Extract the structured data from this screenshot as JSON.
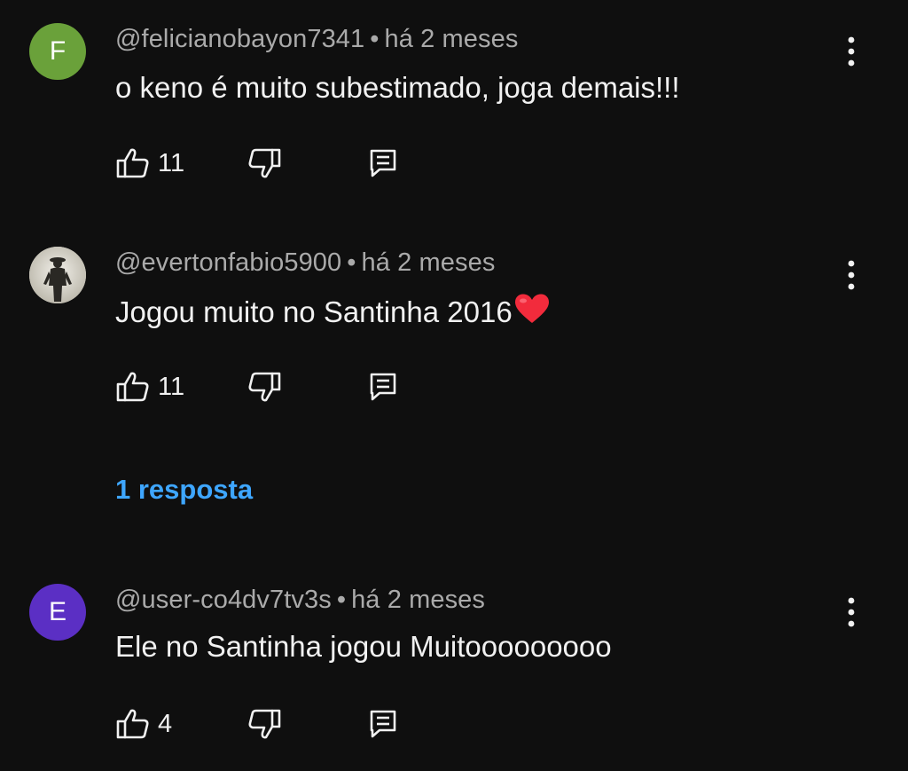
{
  "comments": [
    {
      "avatar": {
        "letter": "F",
        "color": "#6aa13a",
        "type": "letter"
      },
      "author": "@felicianobayon7341",
      "separator": "•",
      "time": "há 2 meses",
      "text": "o keno é muito subestimado, joga demais!!!",
      "likes": "11",
      "menu_icon": "more-vert-icon",
      "like_icon": "thumb-up-icon",
      "dislike_icon": "thumb-down-icon",
      "reply_icon": "reply-comment-icon"
    },
    {
      "avatar": {
        "type": "photo"
      },
      "author": "@evertonfabio5900",
      "separator": "•",
      "time": "há 2 meses",
      "text": "Jogou muito no Santinha 2016",
      "emoji": "❤️",
      "likes": "11",
      "replies": "1 resposta",
      "menu_icon": "more-vert-icon",
      "like_icon": "thumb-up-icon",
      "dislike_icon": "thumb-down-icon",
      "reply_icon": "reply-comment-icon"
    },
    {
      "avatar": {
        "letter": "E",
        "color": "#5b2fc4",
        "type": "letter"
      },
      "author": "@user-co4dv7tv3s",
      "separator": "•",
      "time": "há 2 meses",
      "text": "Ele no Santinha jogou Muitooooooooo",
      "likes": "4",
      "menu_icon": "more-vert-icon",
      "like_icon": "thumb-up-icon",
      "dislike_icon": "thumb-down-icon",
      "reply_icon": "reply-comment-icon"
    }
  ],
  "colors": {
    "background": "#0f0f0f",
    "primary_text": "#f1f1f1",
    "secondary_text": "#aaaaaa",
    "link": "#3ea6ff"
  }
}
